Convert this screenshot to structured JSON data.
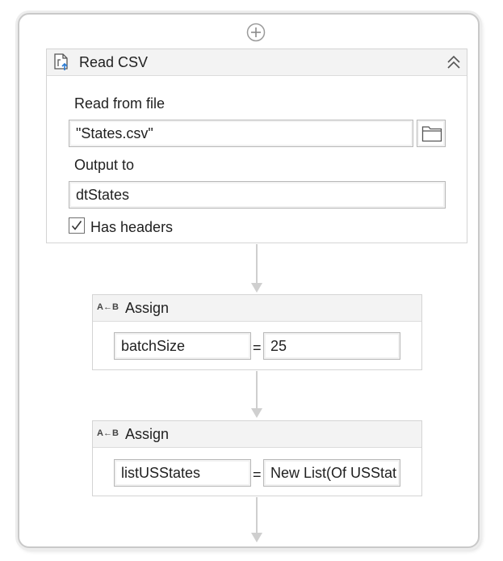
{
  "read_csv": {
    "title": "Read CSV",
    "read_from_label": "Read from file",
    "read_from_value": "\"States.csv\"",
    "output_label": "Output to",
    "output_value": "dtStates",
    "has_headers_label": "Has headers",
    "has_headers_checked": true,
    "icon": "read-csv-icon"
  },
  "assign_1": {
    "title": "Assign",
    "icon_text": "A←B",
    "to_value": "batchSize",
    "equals": "=",
    "value": "25"
  },
  "assign_2": {
    "title": "Assign",
    "icon_text": "A←B",
    "to_value": "listUSStates",
    "equals": "=",
    "value": "New List(Of USStat"
  },
  "colors": {
    "header_bg": "#f3f3f3",
    "border": "#d4d4d4",
    "connector": "#cfcfcf",
    "accent": "#2a7bd3"
  }
}
